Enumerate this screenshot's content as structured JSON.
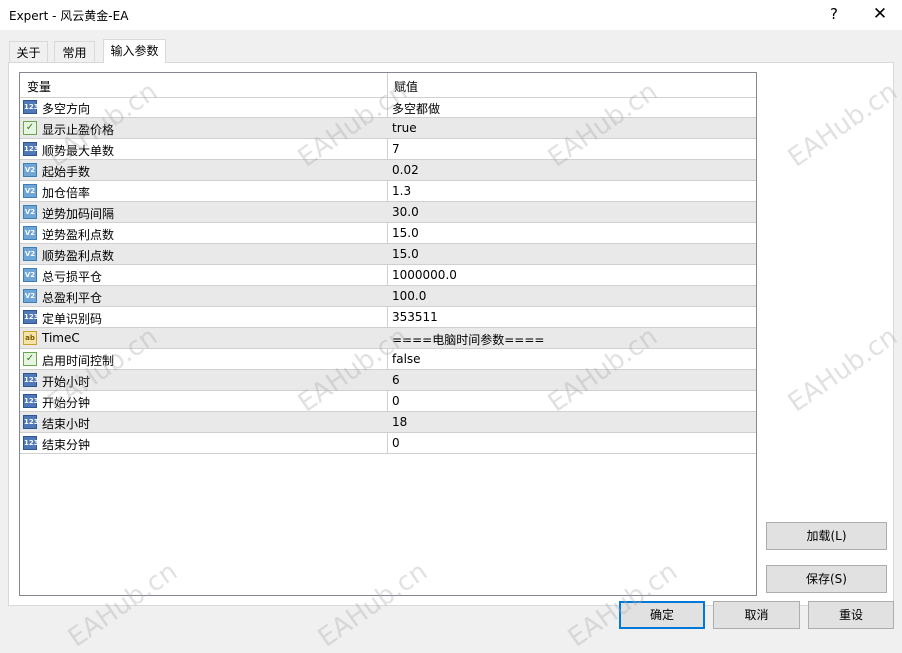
{
  "window": {
    "title": "Expert - 风云黄金-EA",
    "help_glyph": "?",
    "close_glyph": "✕"
  },
  "tabs": [
    {
      "label": "关于"
    },
    {
      "label": "常用"
    },
    {
      "label": "输入参数",
      "active": true
    }
  ],
  "grid": {
    "col_variable": "变量",
    "col_value": "赋值",
    "rows": [
      {
        "icon": "int-type-icon",
        "icon_text": "123",
        "name": "多空方向",
        "value": "多空都做"
      },
      {
        "icon": "bool-type-icon",
        "icon_text": "✓",
        "name": "显示止盈价格",
        "value": "true"
      },
      {
        "icon": "int-type-icon",
        "icon_text": "123",
        "name": "顺势最大单数",
        "value": "7"
      },
      {
        "icon": "double-type-icon",
        "icon_text": "V2",
        "name": "起始手数",
        "value": "0.02"
      },
      {
        "icon": "double-type-icon",
        "icon_text": "V2",
        "name": "加仓倍率",
        "value": "1.3"
      },
      {
        "icon": "double-type-icon",
        "icon_text": "V2",
        "name": "逆势加码间隔",
        "value": "30.0"
      },
      {
        "icon": "double-type-icon",
        "icon_text": "V2",
        "name": "逆势盈利点数",
        "value": "15.0"
      },
      {
        "icon": "double-type-icon",
        "icon_text": "V2",
        "name": "顺势盈利点数",
        "value": "15.0"
      },
      {
        "icon": "double-type-icon",
        "icon_text": "V2",
        "name": "总亏损平仓",
        "value": "1000000.0"
      },
      {
        "icon": "double-type-icon",
        "icon_text": "V2",
        "name": "总盈利平仓",
        "value": "100.0"
      },
      {
        "icon": "int-type-icon",
        "icon_text": "123",
        "name": "定单识别码",
        "value": "353511"
      },
      {
        "icon": "string-type-icon",
        "icon_text": "ab",
        "name": "TimeC",
        "value": "====电脑时间参数===="
      },
      {
        "icon": "bool-type-icon",
        "icon_text": "✓",
        "name": "启用时间控制",
        "value": "false"
      },
      {
        "icon": "int-type-icon",
        "icon_text": "123",
        "name": "开始小时",
        "value": "6"
      },
      {
        "icon": "int-type-icon",
        "icon_text": "123",
        "name": "开始分钟",
        "value": "0"
      },
      {
        "icon": "int-type-icon",
        "icon_text": "123",
        "name": "结束小时",
        "value": "18"
      },
      {
        "icon": "int-type-icon",
        "icon_text": "123",
        "name": "结束分钟",
        "value": "0"
      }
    ]
  },
  "buttons": {
    "load": "加载(L)",
    "save": "保存(S)",
    "ok": "确定",
    "cancel": "取消",
    "reset": "重设"
  },
  "watermark": "EAHub.cn",
  "colors": {
    "accent": "#0078d7",
    "alt_row": "#e9e9e9"
  }
}
